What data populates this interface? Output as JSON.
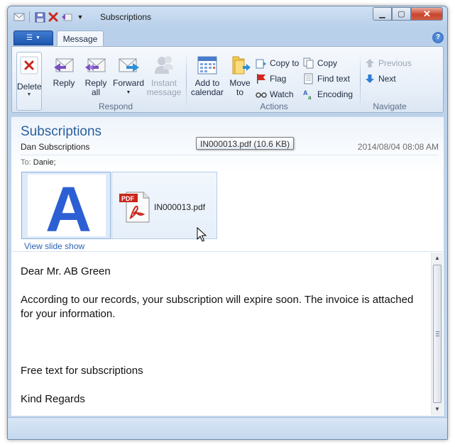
{
  "window": {
    "title": "Subscriptions"
  },
  "tabs": {
    "file_label": "☰",
    "message": "Message",
    "help": "?"
  },
  "ribbon": {
    "delete": {
      "label": "Delete"
    },
    "respond": {
      "group": "Respond",
      "reply": "Reply",
      "reply_all_1": "Reply",
      "reply_all_2": "all",
      "forward": "Forward",
      "instant_1": "Instant",
      "instant_2": "message"
    },
    "actions": {
      "group": "Actions",
      "add_calendar_1": "Add to",
      "add_calendar_2": "calendar",
      "move_to_1": "Move",
      "move_to_2": "to",
      "copy_to": "Copy to",
      "flag": "Flag",
      "watch": "Watch",
      "copy": "Copy",
      "find_text": "Find text",
      "encoding": "Encoding"
    },
    "navigate": {
      "group": "Navigate",
      "previous": "Previous",
      "next": "Next"
    }
  },
  "message": {
    "subject": "Subscriptions",
    "from": "Dan Subscriptions",
    "date": "2014/08/04 08:08 AM",
    "to_label": "To:",
    "to_value": "Danie;",
    "attachment_name": "IN000013.pdf",
    "attachment_tooltip": "IN000013.pdf (10.6 KB)",
    "slideshow_link": "View slide show",
    "image_letter": "A",
    "pdf_badge": "PDF",
    "body": {
      "greeting": "Dear Mr. AB Green",
      "paragraph": "According to our records, your subscription will expire soon. The invoice is attached for your information.",
      "free_text": "Free text for subscriptions",
      "closing": "Kind Regards"
    }
  },
  "colors": {
    "subject": "#2a5f9e",
    "link": "#2c64b3",
    "close_button": "#c9452f"
  }
}
